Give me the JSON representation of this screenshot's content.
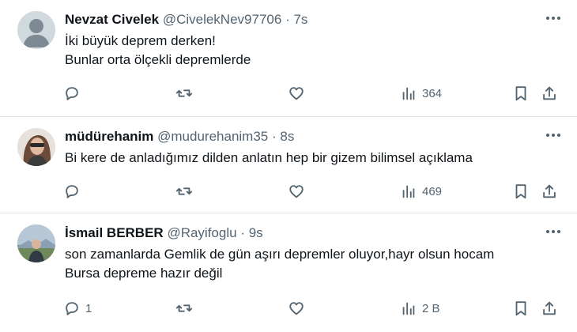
{
  "tweets": [
    {
      "name": "Nevzat Civelek",
      "handle": "@CivelekNev97706",
      "dot": "·",
      "time": "7s",
      "lines": [
        "İki büyük deprem derken!",
        "Bunlar orta ölçekli depremlerde"
      ],
      "reply_count": "",
      "views": "364",
      "avatar": "default-avatar"
    },
    {
      "name": "müdürehanim",
      "handle": "@mudurehanim35",
      "dot": "·",
      "time": "8s",
      "lines": [
        "Bi kere de anladığımız dilden anlatın hep bir gizem bilimsel açıklama"
      ],
      "reply_count": "",
      "views": "469",
      "avatar": "photo-avatar"
    },
    {
      "name": "İsmail BERBER",
      "handle": "@Rayifoglu",
      "dot": "·",
      "time": "9s",
      "lines": [
        "son zamanlarda Gemlik de gün aşırı depremler oluyor,hayr olsun hocam",
        "Bursa depreme hazır değil"
      ],
      "reply_count": "1",
      "views": "2 B",
      "avatar": "photo-avatar"
    }
  ],
  "colors": {
    "text": "#0f1419",
    "muted": "#536471",
    "divider": "#e3e6e9"
  }
}
